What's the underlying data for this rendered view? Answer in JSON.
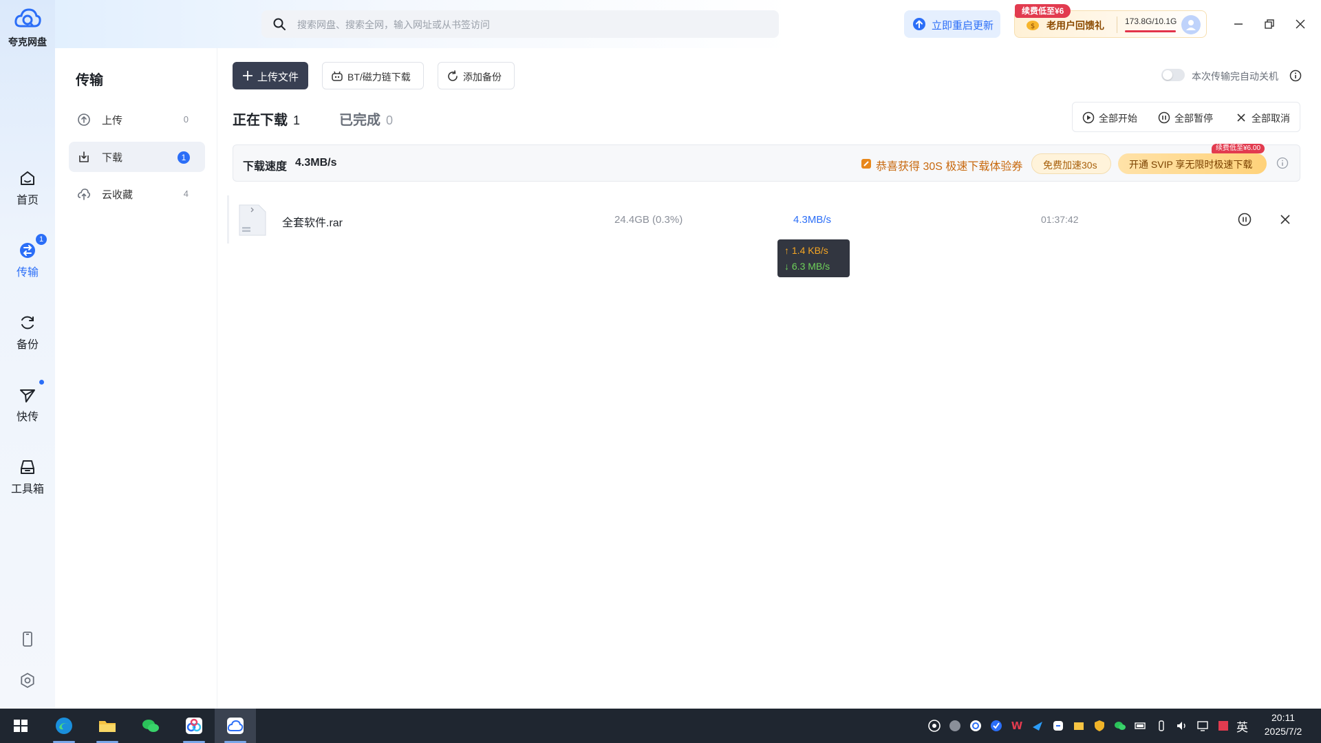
{
  "app": {
    "name": "夸克网盘"
  },
  "rail": {
    "items": [
      {
        "label": "首页"
      },
      {
        "label": "传输",
        "badge": "1"
      },
      {
        "label": "备份"
      },
      {
        "label": "快传"
      },
      {
        "label": "工具箱"
      }
    ]
  },
  "search": {
    "placeholder": "搜索网盘、搜索全网，输入网址或从书签访问"
  },
  "header": {
    "update_label": "立即重启更新",
    "promo_tag": "续费低至¥6",
    "promo_label": "老用户回馈礼",
    "quota": "173.8G/10.1G",
    "quota_fill": 1.0
  },
  "sidebar": {
    "title": "传输",
    "items": [
      {
        "label": "上传",
        "count": "0"
      },
      {
        "label": "下载",
        "count": "1"
      },
      {
        "label": "云收藏",
        "count": "4"
      }
    ]
  },
  "toolbar": {
    "upload_label": "上传文件",
    "bt_label": "BT/磁力链下载",
    "backup_label": "添加备份",
    "auto_shutdown_label": "本次传输完自动关机",
    "auto_shutdown_on": false
  },
  "tabs": [
    {
      "label": "正在下载",
      "count": "1"
    },
    {
      "label": "已完成",
      "count": "0"
    }
  ],
  "bulk": {
    "start_all": "全部开始",
    "pause_all": "全部暂停",
    "cancel_all": "全部取消"
  },
  "speedbar": {
    "label": "下载速度",
    "speed": "4.3MB/s",
    "congrats": "恭喜获得 30S 极速下载体验券",
    "free_boost": "免费加速30s",
    "svip": "开通 SVIP 享无限时极速下载",
    "svip_tag": "续费低至¥6.00"
  },
  "downloads": [
    {
      "name": "全套软件.rar",
      "size": "24.4GB (0.3%)",
      "speed": "4.3MB/s",
      "eta": "01:37:42",
      "tooltip_up": "↑ 1.4 KB/s",
      "tooltip_down": "↓ 6.3 MB/s"
    }
  ],
  "taskbar": {
    "lang": "英",
    "time": "20:11",
    "date": "2025/7/2"
  },
  "colors": {
    "accent": "#2b6ef7",
    "dark_button": "#383f52",
    "promo_red": "#e23b4f",
    "gold_text": "#c8690e"
  }
}
